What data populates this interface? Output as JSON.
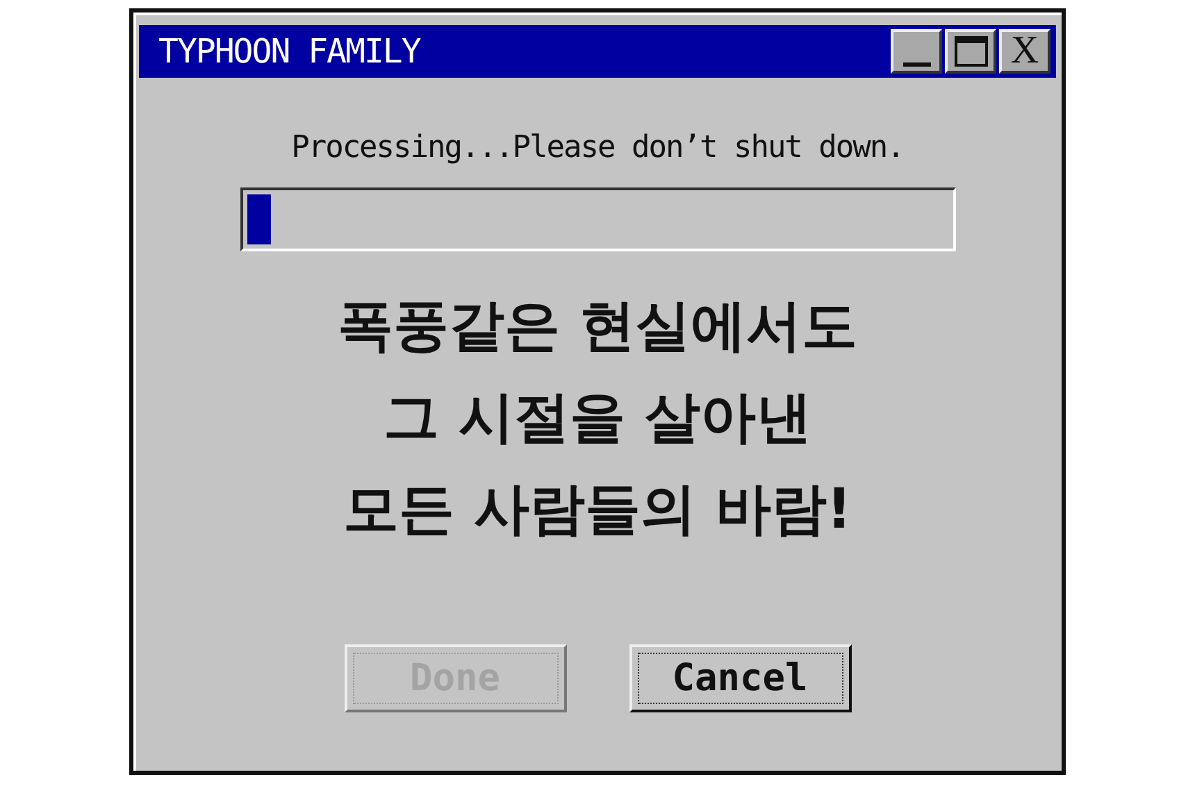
{
  "window": {
    "title": "TYPHOON FAMILY",
    "close_label": "X"
  },
  "message": "Processing...Please don’t shut down.",
  "progress": {
    "level": 0.035
  },
  "slogan": [
    "폭풍같은 현실에서도",
    "그 시절을 살아낸",
    "모든 사람들의 바람!"
  ],
  "buttons": [
    {
      "label": "Done",
      "disabled": true
    },
    {
      "label": "Cancel",
      "disabled": false
    }
  ]
}
